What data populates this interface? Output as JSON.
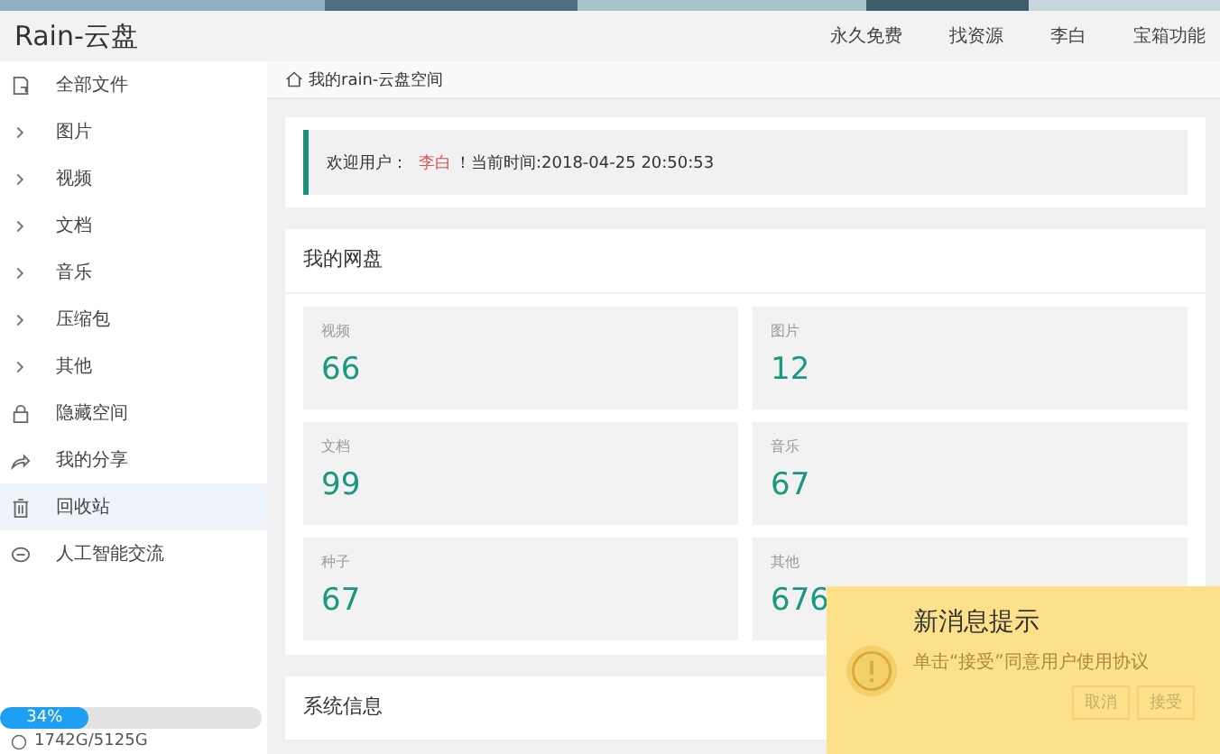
{
  "app_title": "Rain-云盘",
  "top_nav": [
    "永久免费",
    "找资源",
    "李白",
    "宝箱功能"
  ],
  "sidebar": {
    "items": [
      {
        "label": "全部文件",
        "kind": "file",
        "selected": false
      },
      {
        "label": "图片",
        "kind": "chevron",
        "selected": false
      },
      {
        "label": "视频",
        "kind": "chevron",
        "selected": false
      },
      {
        "label": "文档",
        "kind": "chevron",
        "selected": false
      },
      {
        "label": "音乐",
        "kind": "chevron",
        "selected": false
      },
      {
        "label": "压缩包",
        "kind": "chevron",
        "selected": false
      },
      {
        "label": "其他",
        "kind": "chevron",
        "selected": false
      },
      {
        "label": "隐藏空间",
        "kind": "lock",
        "selected": false
      },
      {
        "label": "我的分享",
        "kind": "share",
        "selected": false
      },
      {
        "label": "回收站",
        "kind": "trash",
        "selected": true
      },
      {
        "label": "人工智能交流",
        "kind": "chat",
        "selected": false
      }
    ],
    "storage": {
      "level": 0.34,
      "percent": "34%",
      "usage": "1742G/5125G"
    }
  },
  "breadcrumb": "我的rain-云盘空间",
  "welcome": {
    "prefix": "欢迎用户：",
    "user": "李白",
    "suffix": "！当前时间:2018-04-25 20:50:53"
  },
  "disk": {
    "title": "我的网盘",
    "stats": [
      {
        "label": "视频",
        "value": "66"
      },
      {
        "label": "图片",
        "value": "12"
      },
      {
        "label": "文档",
        "value": "99"
      },
      {
        "label": "音乐",
        "value": "67"
      },
      {
        "label": "种子",
        "value": "67"
      },
      {
        "label": "其他",
        "value": "676"
      }
    ]
  },
  "system": {
    "title": "系统信息"
  },
  "notification": {
    "title": "新消息提示",
    "message": "单击“接受”同意用户使用协议",
    "buttons": [
      "取消",
      "接受"
    ]
  }
}
